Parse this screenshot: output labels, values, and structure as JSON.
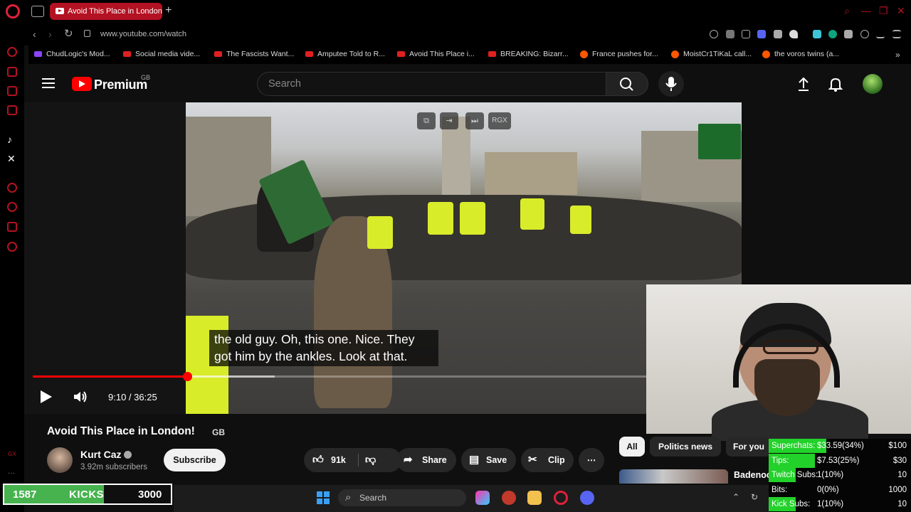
{
  "browser": {
    "tab_title": "Avoid This Place in London",
    "url": "www.youtube.com/watch",
    "bookmarks": [
      "ChudLogic's Mod...",
      "Social media vide...",
      "The Fascists Want...",
      "Amputee Told to R...",
      "Avoid This Place i...",
      "BREAKING: Bizarr...",
      "France pushes for...",
      "MoistCr1TiKaL call...",
      "the voros twins (a..."
    ]
  },
  "youtube": {
    "logo_text": "Premium",
    "region": "GB",
    "search_placeholder": "Search"
  },
  "player": {
    "caption_line1": "the old guy. Oh, this one. Nice. They",
    "caption_line2": "got him by the ankles. Look at that.",
    "time": "9:10 / 36:25",
    "progress_fraction": 0.252,
    "hud_label": "RGX"
  },
  "video": {
    "title": "Avoid This Place in London!",
    "title_tag": "GB",
    "channel": "Kurt Caz",
    "subscribers": "3.92m subscribers",
    "subscribe_label": "Subscribe",
    "likes": "91k",
    "share_label": "Share",
    "save_label": "Save",
    "clip_label": "Clip"
  },
  "related": {
    "chips": [
      "All",
      "Politics news",
      "For you"
    ],
    "first_title": "Badenoch"
  },
  "stream_goals": [
    {
      "label": "Superchats:",
      "value": "$33.59(34%)",
      "max": "$100",
      "fraction": 0.34
    },
    {
      "label": "Tips:",
      "value": "$7.53(25%)",
      "max": "$30",
      "fraction": 0.25
    },
    {
      "label": "Twitch Subs:",
      "value": "1(10%)",
      "max": "10",
      "fraction": 0.1
    },
    {
      "label": "Bits:",
      "value": "0(0%)",
      "max": "1000",
      "fraction": 0.0
    },
    {
      "label": "Kick Subs:",
      "value": "1(10%)",
      "max": "10",
      "fraction": 0.1
    }
  ],
  "kicks": {
    "current": "1587",
    "label": "KICKS",
    "goal": "3000"
  },
  "taskbar": {
    "search_label": "Search"
  }
}
